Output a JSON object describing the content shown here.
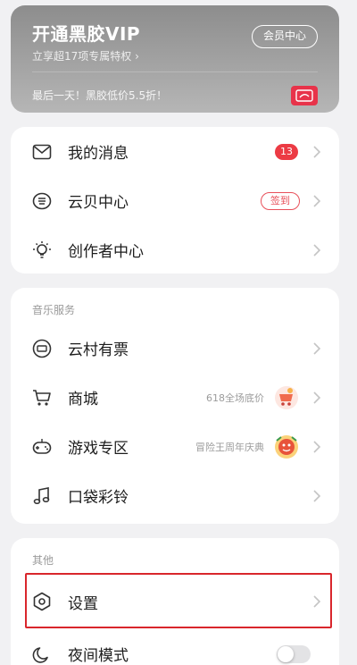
{
  "vip": {
    "title": "开通黑胶VIP",
    "subtitle": "立享超17项专属特权 ›",
    "center_button": "会员中心",
    "promo": "最后一天！黑胶低价5.5折！"
  },
  "menu_main": [
    {
      "label": "我的消息",
      "badge": "13"
    },
    {
      "label": "云贝中心",
      "pill": "签到"
    },
    {
      "label": "创作者中心"
    }
  ],
  "music_services": {
    "title": "音乐服务",
    "items": [
      {
        "label": "云村有票"
      },
      {
        "label": "商城",
        "promo": "618全场底价"
      },
      {
        "label": "游戏专区",
        "promo": "冒险王周年庆典"
      },
      {
        "label": "口袋彩铃"
      }
    ]
  },
  "other": {
    "title": "其他",
    "items": [
      {
        "label": "设置"
      },
      {
        "label": "夜间模式"
      }
    ]
  },
  "colors": {
    "accent_red": "#ec3b44",
    "highlight": "#d9262c",
    "card_bg": "#ffffff",
    "page_bg": "#f1f1f3"
  }
}
